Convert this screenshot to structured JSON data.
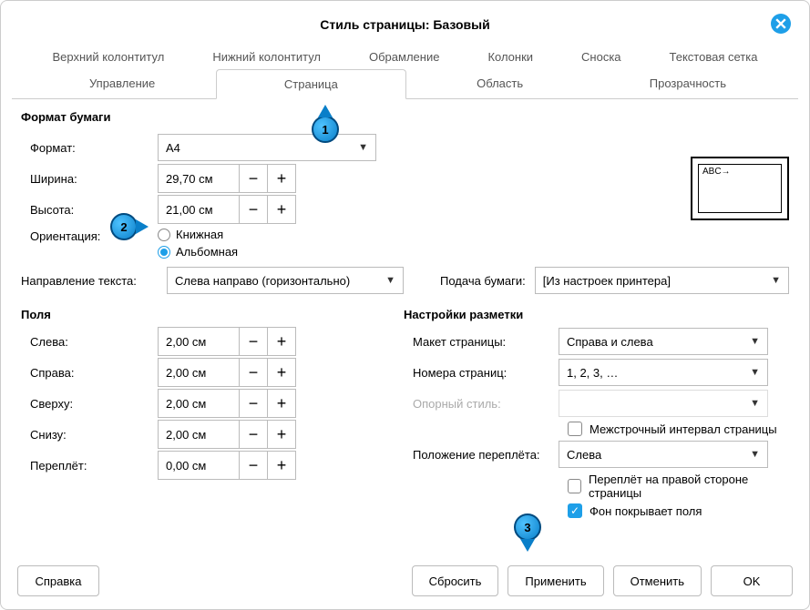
{
  "title": "Стиль страницы: Базовый",
  "tabs_row1": {
    "header": "Верхний колонтитул",
    "footer": "Нижний колонтитул",
    "border": "Обрамление",
    "columns": "Колонки",
    "footnote": "Сноска",
    "textgrid": "Текстовая сетка"
  },
  "tabs_row2": {
    "manage": "Управление",
    "page": "Страница",
    "area": "Область",
    "transparency": "Прозрачность"
  },
  "sections": {
    "paper_format": "Формат бумаги",
    "margins": "Поля",
    "layout_settings": "Настройки разметки"
  },
  "labels": {
    "format": "Формат:",
    "width": "Ширина:",
    "height": "Высота:",
    "orientation": "Ориентация:",
    "portrait": "Книжная",
    "landscape": "Альбомная",
    "text_direction": "Направление текста:",
    "paper_tray": "Подача бумаги:",
    "left": "Слева:",
    "right": "Справа:",
    "top": "Сверху:",
    "bottom": "Снизу:",
    "gutter": "Переплёт:",
    "page_layout": "Макет страницы:",
    "page_numbers": "Номера страниц:",
    "ref_style": "Опорный стиль:",
    "gutter_position": "Положение переплёта:",
    "register_true": "Межстрочный интервал страницы",
    "gutter_right": "Переплёт на правой стороне страницы",
    "background_covers": "Фон покрывает поля"
  },
  "values": {
    "format": "A4",
    "width": "29,70 см",
    "height": "21,00 см",
    "text_direction": "Слева направо (горизонтально)",
    "paper_tray": "[Из настроек принтера]",
    "m_left": "2,00 см",
    "m_right": "2,00 см",
    "m_top": "2,00 см",
    "m_bottom": "2,00 см",
    "m_gutter": "0,00 см",
    "page_layout": "Справа и слева",
    "page_numbers": "1, 2, 3, …",
    "gutter_position": "Слева",
    "preview_text": "ABC→"
  },
  "buttons": {
    "help": "Справка",
    "reset": "Сбросить",
    "apply": "Применить",
    "cancel": "Отменить",
    "ok": "OK"
  },
  "callouts": {
    "c1": "1",
    "c2": "2",
    "c3": "3"
  }
}
